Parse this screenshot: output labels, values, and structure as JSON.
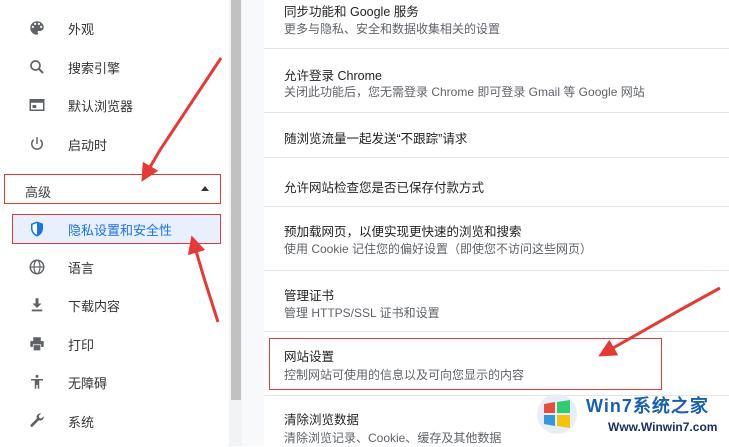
{
  "sidebar": {
    "items": [
      {
        "label": "外观",
        "icon": "palette-icon"
      },
      {
        "label": "搜索引擎",
        "icon": "search-icon"
      },
      {
        "label": "默认浏览器",
        "icon": "browser-window-icon"
      },
      {
        "label": "启动时",
        "icon": "power-icon"
      }
    ],
    "advanced_label": "高级",
    "advanced_items": [
      {
        "label": "隐私设置和安全性",
        "icon": "shield-icon"
      },
      {
        "label": "语言",
        "icon": "globe-icon"
      },
      {
        "label": "下载内容",
        "icon": "download-icon"
      },
      {
        "label": "打印",
        "icon": "printer-icon"
      },
      {
        "label": "无障碍",
        "icon": "accessibility-icon"
      },
      {
        "label": "系统",
        "icon": "wrench-icon"
      }
    ]
  },
  "main": {
    "rows": [
      {
        "title": "同步功能和 Google 服务",
        "sub": "更多与隐私、安全和数据收集相关的设置"
      },
      {
        "title": "允许登录 Chrome",
        "sub": "关闭此功能后，您无需登录 Chrome 即可登录 Gmail 等 Google 网站"
      },
      {
        "title": "随浏览流量一起发送“不跟踪”请求",
        "sub": ""
      },
      {
        "title": "允许网站检查您是否已保存付款方式",
        "sub": ""
      },
      {
        "title": "预加载网页，以便实现更快速的浏览和搜索",
        "sub": "使用 Cookie 记住您的偏好设置（即使您不访问这些网页）"
      },
      {
        "title": "管理证书",
        "sub": "管理 HTTPS/SSL 证书和设置"
      },
      {
        "title": "网站设置",
        "sub": "控制网站可使用的信息以及可向您显示的内容"
      },
      {
        "title": "清除浏览数据",
        "sub": "清除浏览记录、Cookie、缓存及其他数据"
      }
    ]
  },
  "watermark": {
    "title": "Win7系统之家",
    "url": "Www.Winwin7.com"
  },
  "colors": {
    "highlight_red": "#e53935",
    "selected_bg": "#e8f0fe",
    "accent_blue": "#1a73e8"
  }
}
